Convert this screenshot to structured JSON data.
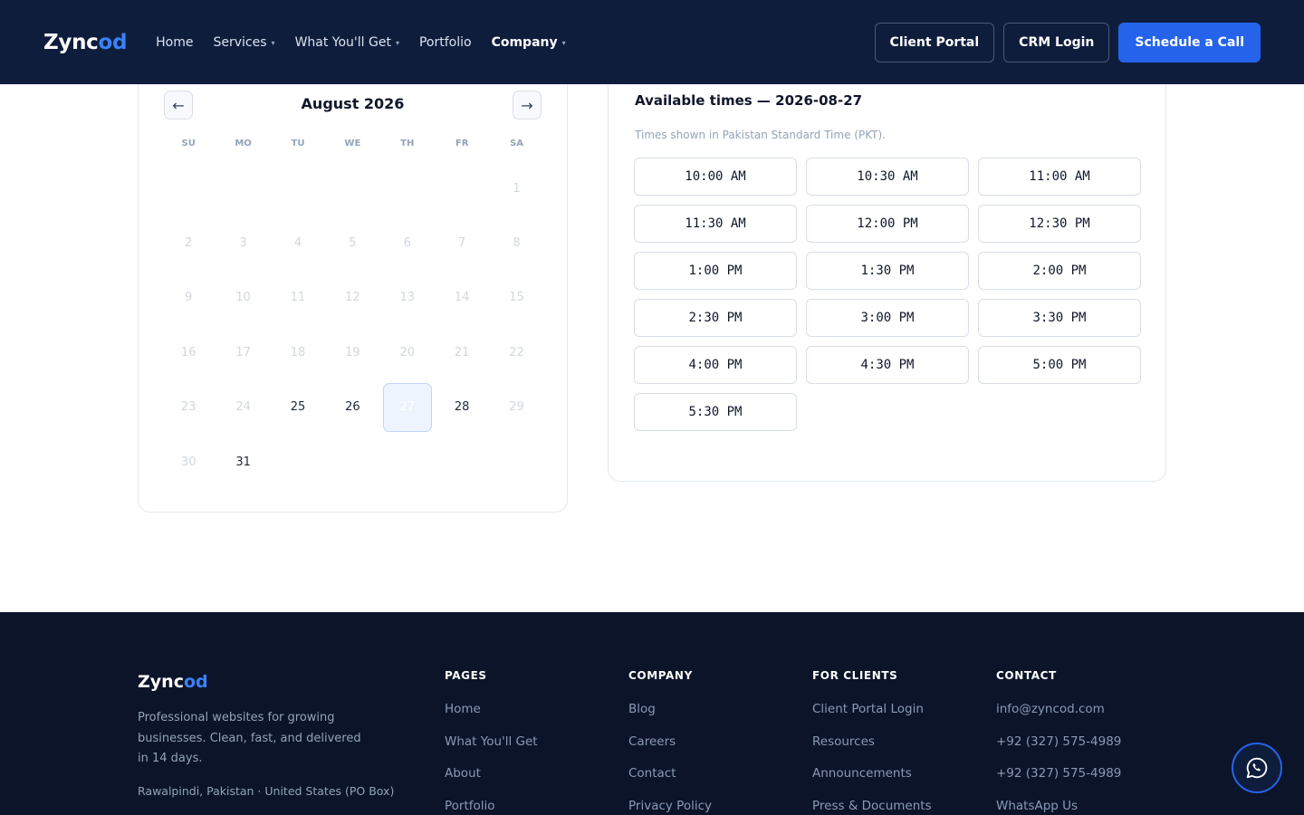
{
  "header": {
    "logo_main": "Zync",
    "logo_accent": "od",
    "nav": [
      {
        "label": "Home",
        "dropdown": false
      },
      {
        "label": "Services",
        "dropdown": true
      },
      {
        "label": "What You'll Get",
        "dropdown": true
      },
      {
        "label": "Portfolio",
        "dropdown": false
      },
      {
        "label": "Company",
        "dropdown": true
      }
    ],
    "client_portal": "Client Portal",
    "crm_login": "CRM Login",
    "schedule_call": "Schedule a Call"
  },
  "calendar": {
    "prev": "←",
    "next": "→",
    "month": "August 2026",
    "weekdays": [
      "SU",
      "MO",
      "TU",
      "WE",
      "TH",
      "FR",
      "SA"
    ],
    "days": [
      "",
      "",
      "",
      "",
      "",
      "",
      "1",
      "2",
      "3",
      "4",
      "5",
      "6",
      "7",
      "8",
      "9",
      "10",
      "11",
      "12",
      "13",
      "14",
      "15",
      "16",
      "17",
      "18",
      "19",
      "20",
      "21",
      "22",
      "23",
      "24",
      "25",
      "26",
      "27",
      "28",
      "29",
      "30",
      "31",
      "",
      "",
      "",
      "",
      ""
    ],
    "available_days": [
      "25",
      "26",
      "27",
      "28",
      "31"
    ],
    "selected_day": "27"
  },
  "times": {
    "title": "Available times — 2026-08-27",
    "subtitle": "Times shown in Pakistan Standard Time (PKT).",
    "slots": [
      "10:00 AM",
      "10:30 AM",
      "11:00 AM",
      "11:30 AM",
      "12:00 PM",
      "12:30 PM",
      "1:00 PM",
      "1:30 PM",
      "2:00 PM",
      "2:30 PM",
      "3:00 PM",
      "3:30 PM",
      "4:00 PM",
      "4:30 PM",
      "5:00 PM",
      "5:30 PM"
    ]
  },
  "footer": {
    "logo_main": "Zync",
    "logo_accent": "od",
    "description": "Professional websites for growing businesses. Clean, fast, and delivered in 14 days.",
    "location": "Rawalpindi, Pakistan · United States (PO Box)",
    "columns": [
      {
        "heading": "PAGES",
        "links": [
          "Home",
          "What You'll Get",
          "About",
          "Portfolio"
        ]
      },
      {
        "heading": "COMPANY",
        "links": [
          "Blog",
          "Careers",
          "Contact",
          "Privacy Policy"
        ]
      },
      {
        "heading": "FOR CLIENTS",
        "links": [
          "Client Portal Login",
          "Resources",
          "Announcements",
          "Press & Documents"
        ]
      },
      {
        "heading": "CONTACT",
        "links": [
          "info@zyncod.com",
          "+92 (327) 575-4989",
          "+92 (327) 575-4989",
          "WhatsApp Us"
        ]
      }
    ]
  },
  "whatsapp_icon": "whatsapp-icon",
  "colors": {
    "header_bg": "#0f1d3d",
    "footer_bg": "#0b1429",
    "accent": "#2563eb"
  }
}
